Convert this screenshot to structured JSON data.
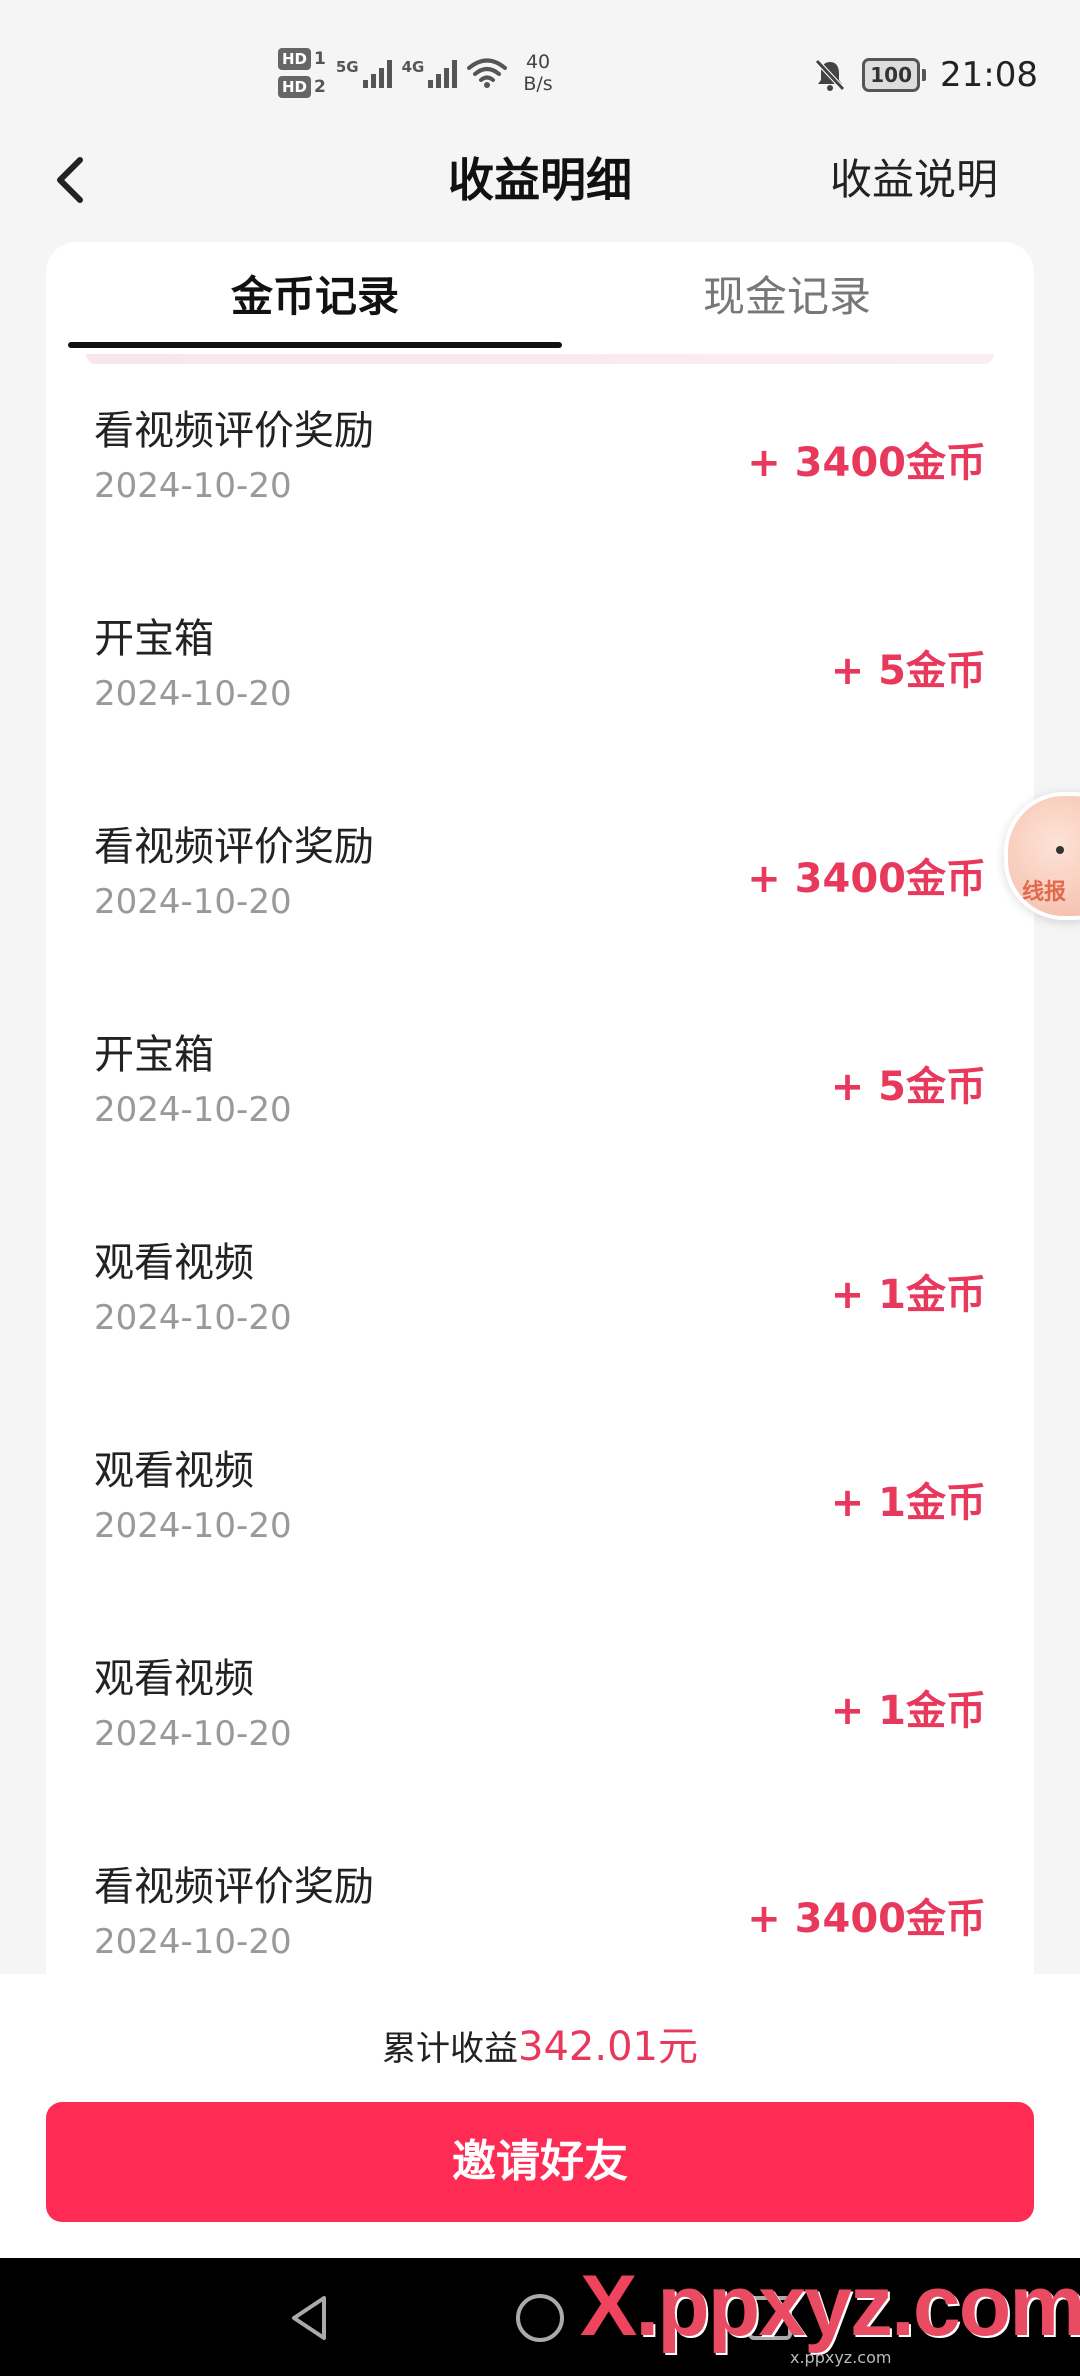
{
  "status_bar": {
    "hd1": "HD",
    "hd1_sub": "1",
    "hd2": "HD",
    "hd2_sub": "2",
    "net1": "5G",
    "net2": "4G",
    "speed_value": "40",
    "speed_unit": "B/s",
    "battery": "100",
    "time": "21:08",
    "icons": [
      "signal-icon",
      "wifi-icon",
      "mute-bell-icon",
      "battery-icon"
    ]
  },
  "header": {
    "title": "收益明细",
    "link": "收益说明",
    "back_icon": "chevron-left-icon"
  },
  "tabs": [
    {
      "label": "金币记录",
      "active": true
    },
    {
      "label": "现金记录",
      "active": false
    }
  ],
  "records": [
    {
      "title": "看视频评价奖励",
      "date": "2024-10-20",
      "amount": "+ 3400金币"
    },
    {
      "title": "开宝箱",
      "date": "2024-10-20",
      "amount": "+ 5金币"
    },
    {
      "title": "看视频评价奖励",
      "date": "2024-10-20",
      "amount": "+ 3400金币"
    },
    {
      "title": "开宝箱",
      "date": "2024-10-20",
      "amount": "+ 5金币"
    },
    {
      "title": "观看视频",
      "date": "2024-10-20",
      "amount": "+ 1金币"
    },
    {
      "title": "观看视频",
      "date": "2024-10-20",
      "amount": "+ 1金币"
    },
    {
      "title": "观看视频",
      "date": "2024-10-20",
      "amount": "+ 1金币"
    },
    {
      "title": "看视频评价奖励",
      "date": "2024-10-20",
      "amount": "+ 3400金币"
    }
  ],
  "summary": {
    "label": "累计收益",
    "value": "342.01元"
  },
  "invite_button": "邀请好友",
  "floating_badge": {
    "text": "线报"
  },
  "watermark": {
    "x": "X",
    "rest": ".ppxyz.com",
    "sub": "x.ppxyz.com"
  },
  "colors": {
    "accent": "#fe2c55",
    "amount": "#e8385b",
    "date": "#999999"
  }
}
